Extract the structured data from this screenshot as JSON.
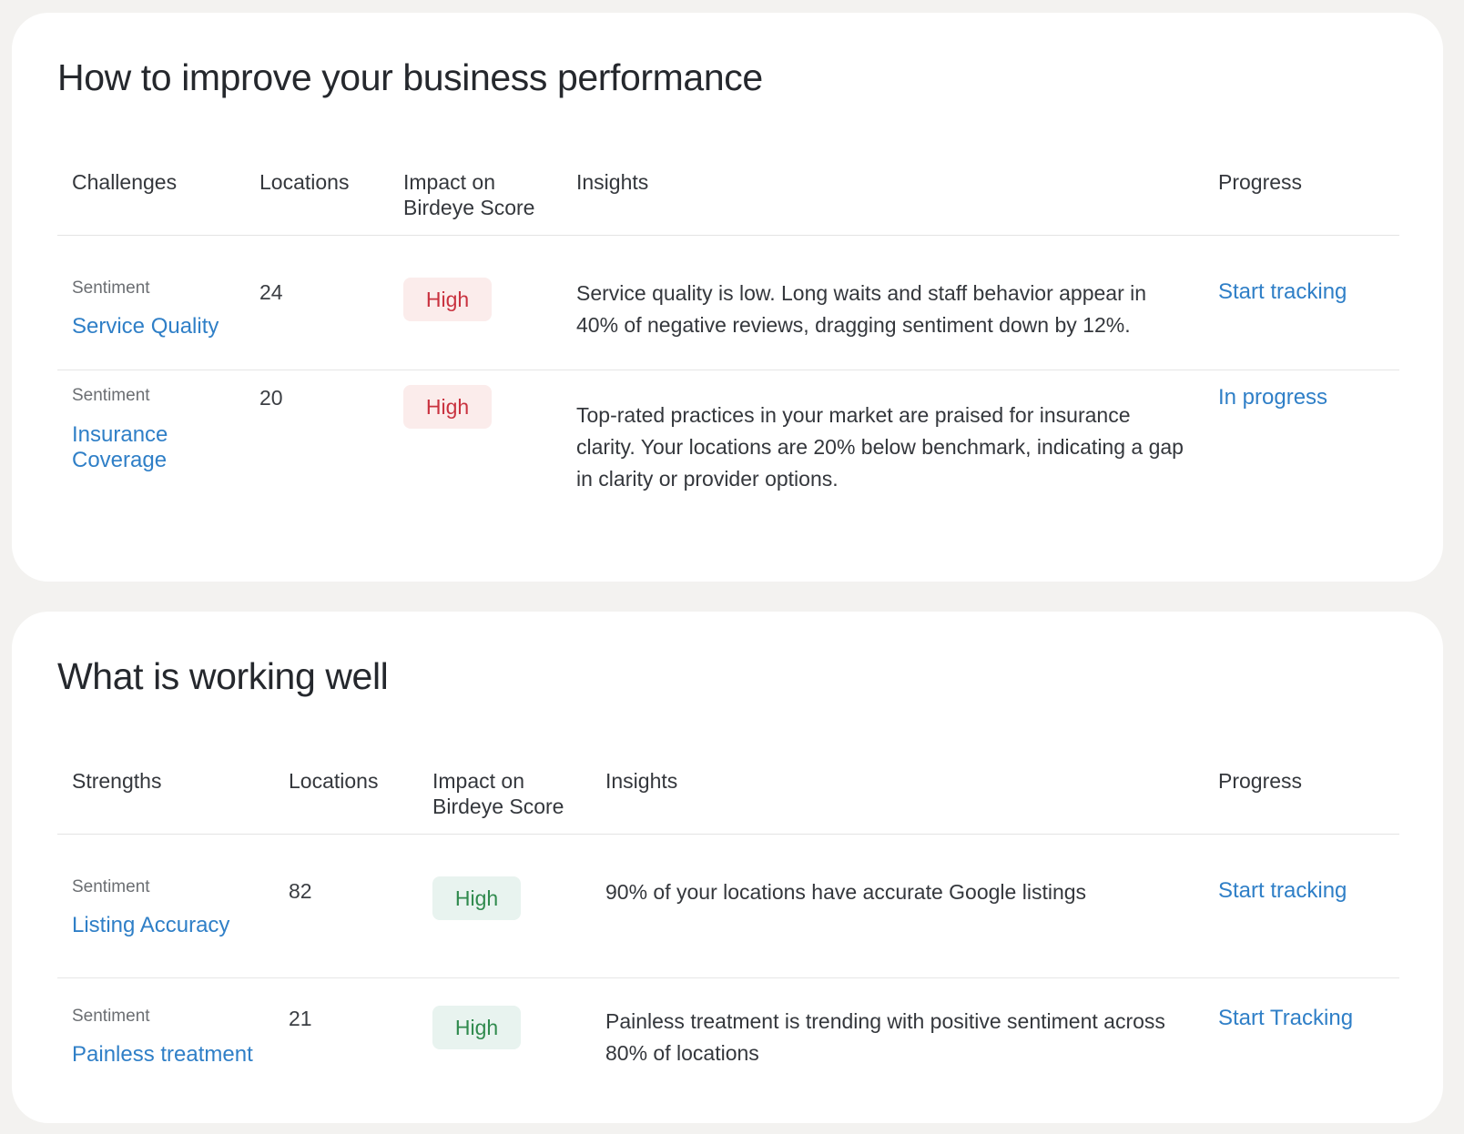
{
  "improve": {
    "title": "How to improve your business performance",
    "headers": {
      "col1": "Challenges",
      "locations": "Locations",
      "impact": "Impact on Birdeye Score",
      "insights": "Insights",
      "progress": "Progress"
    },
    "rows": [
      {
        "category": "Sentiment",
        "metric": "Service Quality",
        "locations": "24",
        "impact": "High",
        "insight": "Service quality is low. Long waits and staff behavior appear in 40% of negative reviews, dragging sentiment down by 12%.",
        "progress": "Start tracking"
      },
      {
        "category": "Sentiment",
        "metric": "Insurance Coverage",
        "locations": "20",
        "impact": "High",
        "insight": "Top-rated practices in your market are praised for insurance clarity. Your locations are 20% below benchmark, indicating a gap in clarity or provider options.",
        "progress": "In progress"
      }
    ]
  },
  "working": {
    "title": "What is working well",
    "headers": {
      "col1": "Strengths",
      "locations": "Locations",
      "impact": "Impact on Birdeye Score",
      "insights": "Insights",
      "progress": "Progress"
    },
    "rows": [
      {
        "category": "Sentiment",
        "metric": "Listing Accuracy",
        "locations": "82",
        "impact": "High",
        "insight": "90% of your locations have accurate Google listings",
        "progress": "Start tracking"
      },
      {
        "category": "Sentiment",
        "metric": "Painless treatment",
        "locations": "21",
        "impact": "High",
        "insight": "Painless treatment is trending with positive sentiment across 80% of locations",
        "progress": "Start Tracking"
      }
    ]
  },
  "colors": {
    "link": "#2f7fc7",
    "negative_badge_bg": "#fbeceb",
    "negative_badge_text": "#c9323f",
    "positive_badge_bg": "#e8f3ef",
    "positive_badge_text": "#2f8a4d"
  }
}
